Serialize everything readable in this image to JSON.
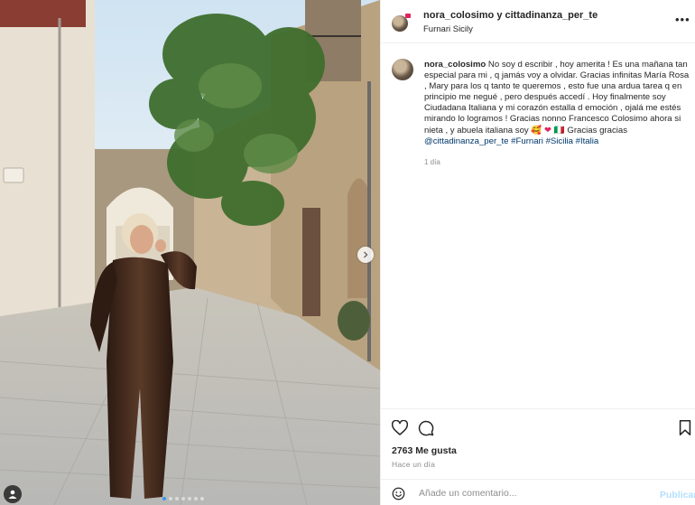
{
  "header": {
    "author": "nora_colosimo",
    "separator": "y",
    "coauthor": "cittadinanza_per_te",
    "location": "Furnari Sicily",
    "more_icon": "ellipsis-icon"
  },
  "caption": {
    "username": "nora_colosimo",
    "text_1": "No soy d escribir , hoy amerita ! Es una mañana tan especial para mi , q jamás voy a olvidar. Gracias infinitas María Rosa , Mary para los q tanto te queremos , esto fue una ardua tarea q en principio me negué , pero después accedí . Hoy finalmente soy Ciudadana Italiana y mi corazón estalla d emoción , ojalá me estés mirando lo logramos ! Gracias nonno Francesco Colosimo ahora si nieta , y abuela italiana soy",
    "emoji_1": "🥰",
    "emoji_2": "❤",
    "emoji_3": "🇮🇹",
    "text_2": "Gracias gracias",
    "tag_1": "@cittadinanza_per_te",
    "tag_2": "#Furnari",
    "tag_3": "#Sicilia",
    "tag_4": "#Italia",
    "age": "1 día"
  },
  "stats": {
    "likes": "2763 Me gusta",
    "time": "Hace un día"
  },
  "comment": {
    "placeholder": "Añade un comentario...",
    "publish": "Publicar"
  },
  "carousel": {
    "current": 1,
    "count": 7
  },
  "colors": {
    "link": "#00376b",
    "publish_disabled": "#b2dffc",
    "active_dot": "#3897f0"
  }
}
